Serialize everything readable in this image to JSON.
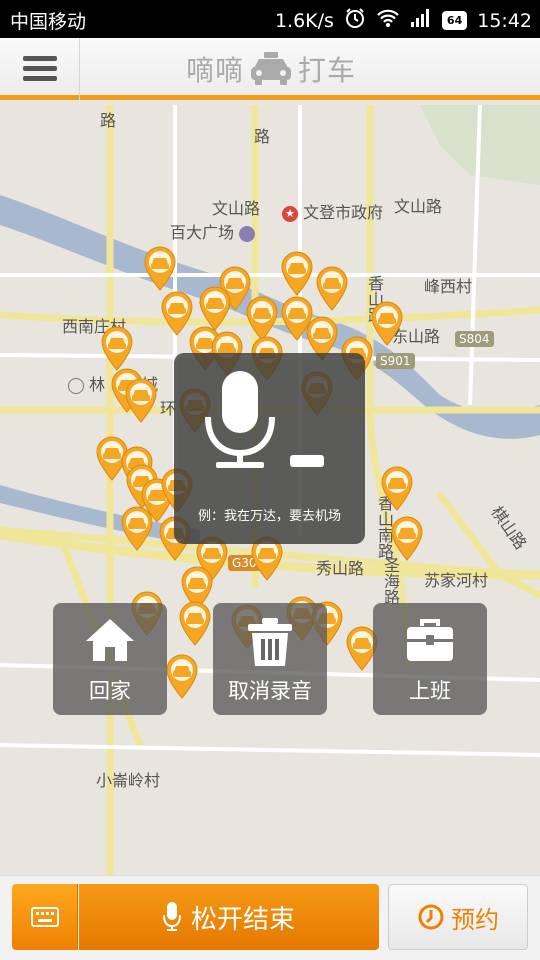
{
  "status_bar": {
    "carrier": "中国移动",
    "speed": "1.6K/s",
    "battery": "64",
    "time": "15:42"
  },
  "header": {
    "title_left": "嘀嘀",
    "title_right": "打车",
    "menu_icon": "hamburger-menu-icon"
  },
  "map": {
    "labels": [
      {
        "text": "路",
        "kind": "road"
      },
      {
        "text": "路",
        "kind": "road"
      },
      {
        "text": "文山路",
        "kind": "road"
      },
      {
        "text": "文登市政府",
        "kind": "poi"
      },
      {
        "text": "文山路",
        "kind": "road"
      },
      {
        "text": "百大广场",
        "kind": "poi"
      },
      {
        "text": "峰西村",
        "kind": "place"
      },
      {
        "text": "西南庄村",
        "kind": "place"
      },
      {
        "text": "S804",
        "kind": "badge"
      },
      {
        "text": "S901",
        "kind": "badge"
      },
      {
        "text": "香山路",
        "kind": "road"
      },
      {
        "text": "东山路",
        "kind": "road"
      },
      {
        "text": "林",
        "kind": "poi"
      },
      {
        "text": "城",
        "kind": "poi"
      },
      {
        "text": "环",
        "kind": "road"
      },
      {
        "text": "G30",
        "kind": "badge"
      },
      {
        "text": "秀山路",
        "kind": "road"
      },
      {
        "text": "香山南路",
        "kind": "road"
      },
      {
        "text": "苏家河村",
        "kind": "place"
      },
      {
        "text": "圣海路",
        "kind": "road"
      },
      {
        "text": "棋山路",
        "kind": "road"
      },
      {
        "text": "小崙岭村",
        "kind": "place"
      }
    ],
    "pin_color": "#f5a623",
    "pin_icon": "taxi-pin-icon"
  },
  "voice": {
    "icon": "microphone-icon",
    "hint": "例：我在万达，要去机场"
  },
  "actions": [
    {
      "label": "回家",
      "icon": "home-icon"
    },
    {
      "label": "取消录音",
      "icon": "trash-icon"
    },
    {
      "label": "上班",
      "icon": "briefcase-icon"
    }
  ],
  "bottom": {
    "keyboard_icon": "keyboard-icon",
    "release_label": "松开结束",
    "reserve_label": "预约",
    "accent": "#ef8100"
  }
}
